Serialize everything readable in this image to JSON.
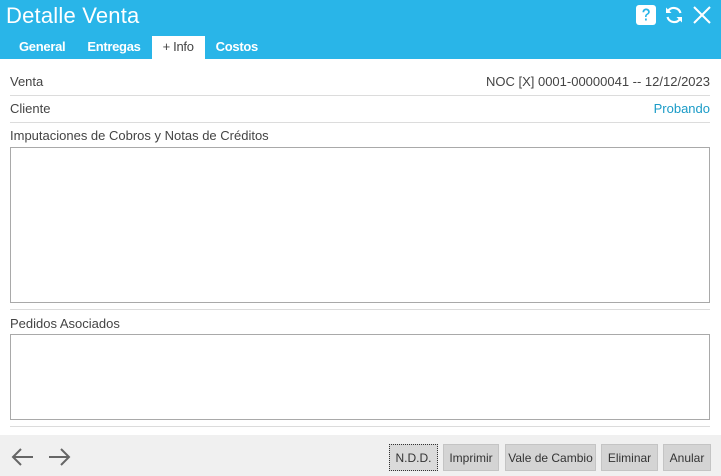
{
  "window": {
    "title": "Detalle Venta",
    "icons": [
      "help-icon",
      "refresh-icon",
      "close-icon"
    ]
  },
  "tabs": [
    {
      "label": "General",
      "active": false
    },
    {
      "label": "Entregas",
      "active": false
    },
    {
      "label": "+ Info",
      "active": true
    },
    {
      "label": "Costos",
      "active": false
    }
  ],
  "info": {
    "venta_label": "Venta",
    "venta_value": "NOC [X] 0001-00000041 -- 12/12/2023",
    "cliente_label": "Cliente",
    "cliente_value": "Probando",
    "imputaciones_label": "Imputaciones de Cobros y Notas de Créditos",
    "pedidos_label": "Pedidos Asociados"
  },
  "footer": {
    "buttons": [
      {
        "label": "N.D.D."
      },
      {
        "label": "Imprimir"
      },
      {
        "label": "Vale de Cambio"
      },
      {
        "label": "Eliminar"
      },
      {
        "label": "Anular"
      }
    ]
  },
  "colors": {
    "header": "#29b5e8",
    "link": "#1a9bc7"
  }
}
